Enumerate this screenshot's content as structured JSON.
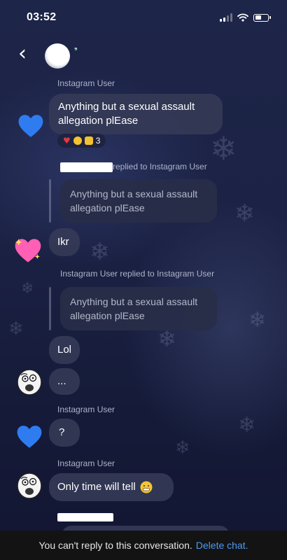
{
  "status_bar": {
    "time": "03:52"
  },
  "header": {
    "name_glyphs": "𝄒𝄒"
  },
  "messages": {
    "m1_sender": "Instagram User",
    "m1_text_line1": "Anything but a sexual assault",
    "m1_text_line2": "allegation plEase",
    "m1_reaction_count": "3",
    "reply1_label": "replied to Instagram User",
    "reply1_quote_line1": "Anything but a sexual assault",
    "reply1_quote_line2": "allegation plEase",
    "m2_text": "Ikr",
    "reply2_label": "Instagram User replied to Instagram User",
    "reply2_quote_line1": "Anything but a sexual assault",
    "reply2_quote_line2": "allegation plEase",
    "m3_text": "Lol",
    "m4_text": "...",
    "m5_sender": "Instagram User",
    "m5_text": "?",
    "m6_sender": "Instagram User",
    "m6_text": "Only time will tell"
  },
  "footer": {
    "notice": "You can't reply to this conversation.",
    "link": "Delete chat."
  },
  "colors": {
    "background": "#1c2245",
    "bubble": "#343a56",
    "link": "#4d9af2",
    "heart_blue": "#2f7cf0",
    "heart_pink": "#ff5fb4"
  },
  "battery_level": 0.55
}
